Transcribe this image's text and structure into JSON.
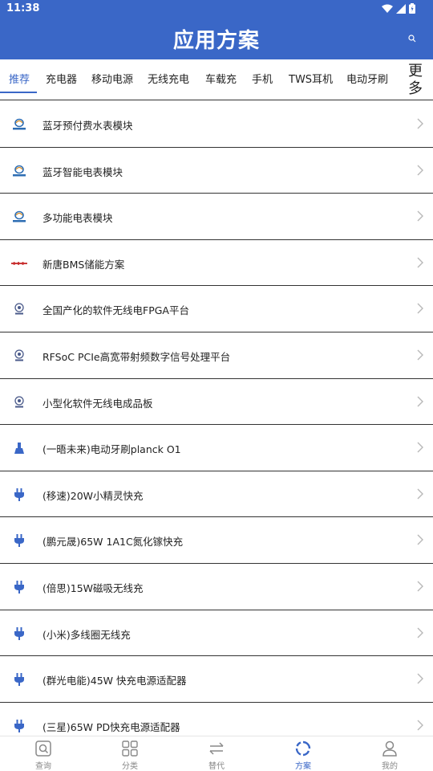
{
  "status_bar": {
    "time": "11:38"
  },
  "header": {
    "title": "应用方案"
  },
  "tabs": [
    {
      "label": "推荐",
      "active": true
    },
    {
      "label": "充电器",
      "active": false
    },
    {
      "label": "移动电源",
      "active": false
    },
    {
      "label": "无线充电",
      "active": false
    },
    {
      "label": "车载充",
      "active": false
    },
    {
      "label": "手机",
      "active": false
    },
    {
      "label": "TWS耳机",
      "active": false
    },
    {
      "label": "电动牙刷",
      "active": false
    }
  ],
  "more_tab": "更多",
  "list": [
    {
      "title": "蓝牙预付费水表模块",
      "logo": "meter-brand-logo"
    },
    {
      "title": "蓝牙智能电表模块",
      "logo": "meter-brand-logo"
    },
    {
      "title": "多功能电表模块",
      "logo": "meter-brand-logo"
    },
    {
      "title": "新唐BMS储能方案",
      "logo": "nuvoton-logo"
    },
    {
      "title": "全国产化的软件无线电FPGA平台",
      "logo": "radio-brand-logo"
    },
    {
      "title": "RFSoC PCIe高宽带射频数字信号处理平台",
      "logo": "radio-brand-logo"
    },
    {
      "title": "小型化软件无线电成品板",
      "logo": "radio-brand-logo"
    },
    {
      "title": "(一晤未来)电动牙刷planck O1",
      "logo": "toothbrush-icon"
    },
    {
      "title": "(移速)20W小精灵快充",
      "logo": "plug-icon"
    },
    {
      "title": "(鹏元晟)65W 1A1C氮化镓快充",
      "logo": "plug-icon"
    },
    {
      "title": "(倍思)15W磁吸无线充",
      "logo": "plug-icon"
    },
    {
      "title": "(小米)多线圈无线充",
      "logo": "plug-icon"
    },
    {
      "title": "(群光电能)45W 快充电源适配器",
      "logo": "plug-icon"
    },
    {
      "title": "(三星)65W PD快充电源适配器",
      "logo": "plug-icon"
    }
  ],
  "bottom_nav": [
    {
      "label": "查询",
      "icon": "search-icon",
      "active": false
    },
    {
      "label": "分类",
      "icon": "grid-icon",
      "active": false
    },
    {
      "label": "替代",
      "icon": "swap-icon",
      "active": false
    },
    {
      "label": "方案",
      "icon": "solution-icon",
      "active": true
    },
    {
      "label": "我的",
      "icon": "user-icon",
      "active": false
    }
  ],
  "colors": {
    "primary": "#3a67c7",
    "text": "#222222",
    "muted": "#888888",
    "chevron": "#b8b8b8"
  }
}
